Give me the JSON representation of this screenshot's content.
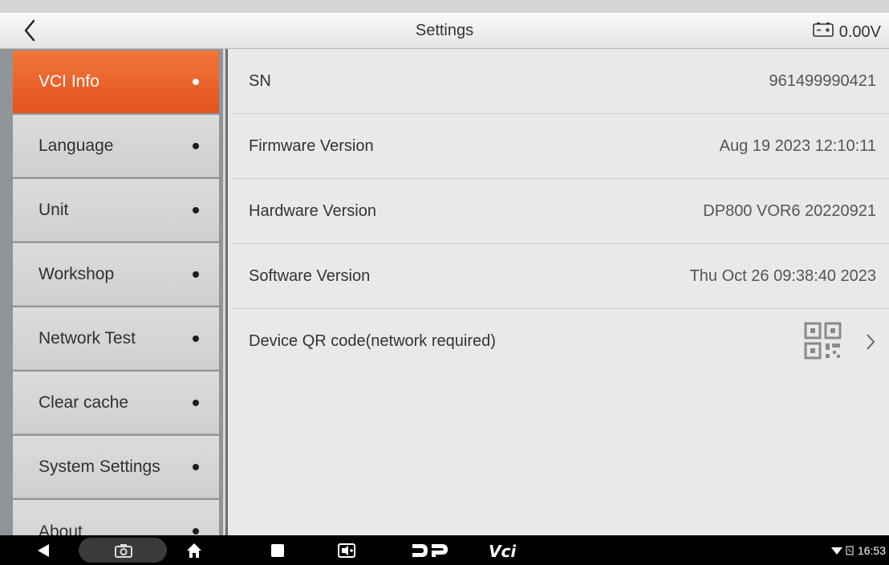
{
  "header": {
    "title": "Settings",
    "voltage": "0.00V"
  },
  "sidebar": {
    "items": [
      {
        "label": "VCI Info",
        "active": true
      },
      {
        "label": "Language",
        "active": false
      },
      {
        "label": "Unit",
        "active": false
      },
      {
        "label": "Workshop",
        "active": false
      },
      {
        "label": "Network Test",
        "active": false
      },
      {
        "label": "Clear cache",
        "active": false
      },
      {
        "label": "System Settings",
        "active": false
      },
      {
        "label": "About",
        "active": false
      }
    ]
  },
  "main": {
    "rows": [
      {
        "label": "SN",
        "value": "961499990421"
      },
      {
        "label": "Firmware Version",
        "value": "Aug 19 2023 12:10:11"
      },
      {
        "label": "Hardware Version",
        "value": "DP800 VOR6 20220921"
      },
      {
        "label": "Software Version",
        "value": "Thu Oct 26 09:38:40 2023"
      }
    ],
    "qr_row": {
      "label": "Device QR code(network required)"
    }
  },
  "navbar": {
    "time": "16:53",
    "app_label": "Vci"
  },
  "colors": {
    "accent": "#e8571f",
    "sidebar_bg": "#8f9598",
    "content_bg": "#e9e9e9",
    "navbar_bg": "#000000"
  },
  "icons": [
    "back-arrow-icon",
    "battery-icon",
    "qr-code-icon",
    "chevron-right-icon",
    "nav-back-icon",
    "camera-icon",
    "home-icon",
    "recent-apps-icon",
    "media-icon",
    "dp-logo-icon",
    "vci-icon",
    "wifi-icon",
    "signal-icon"
  ]
}
